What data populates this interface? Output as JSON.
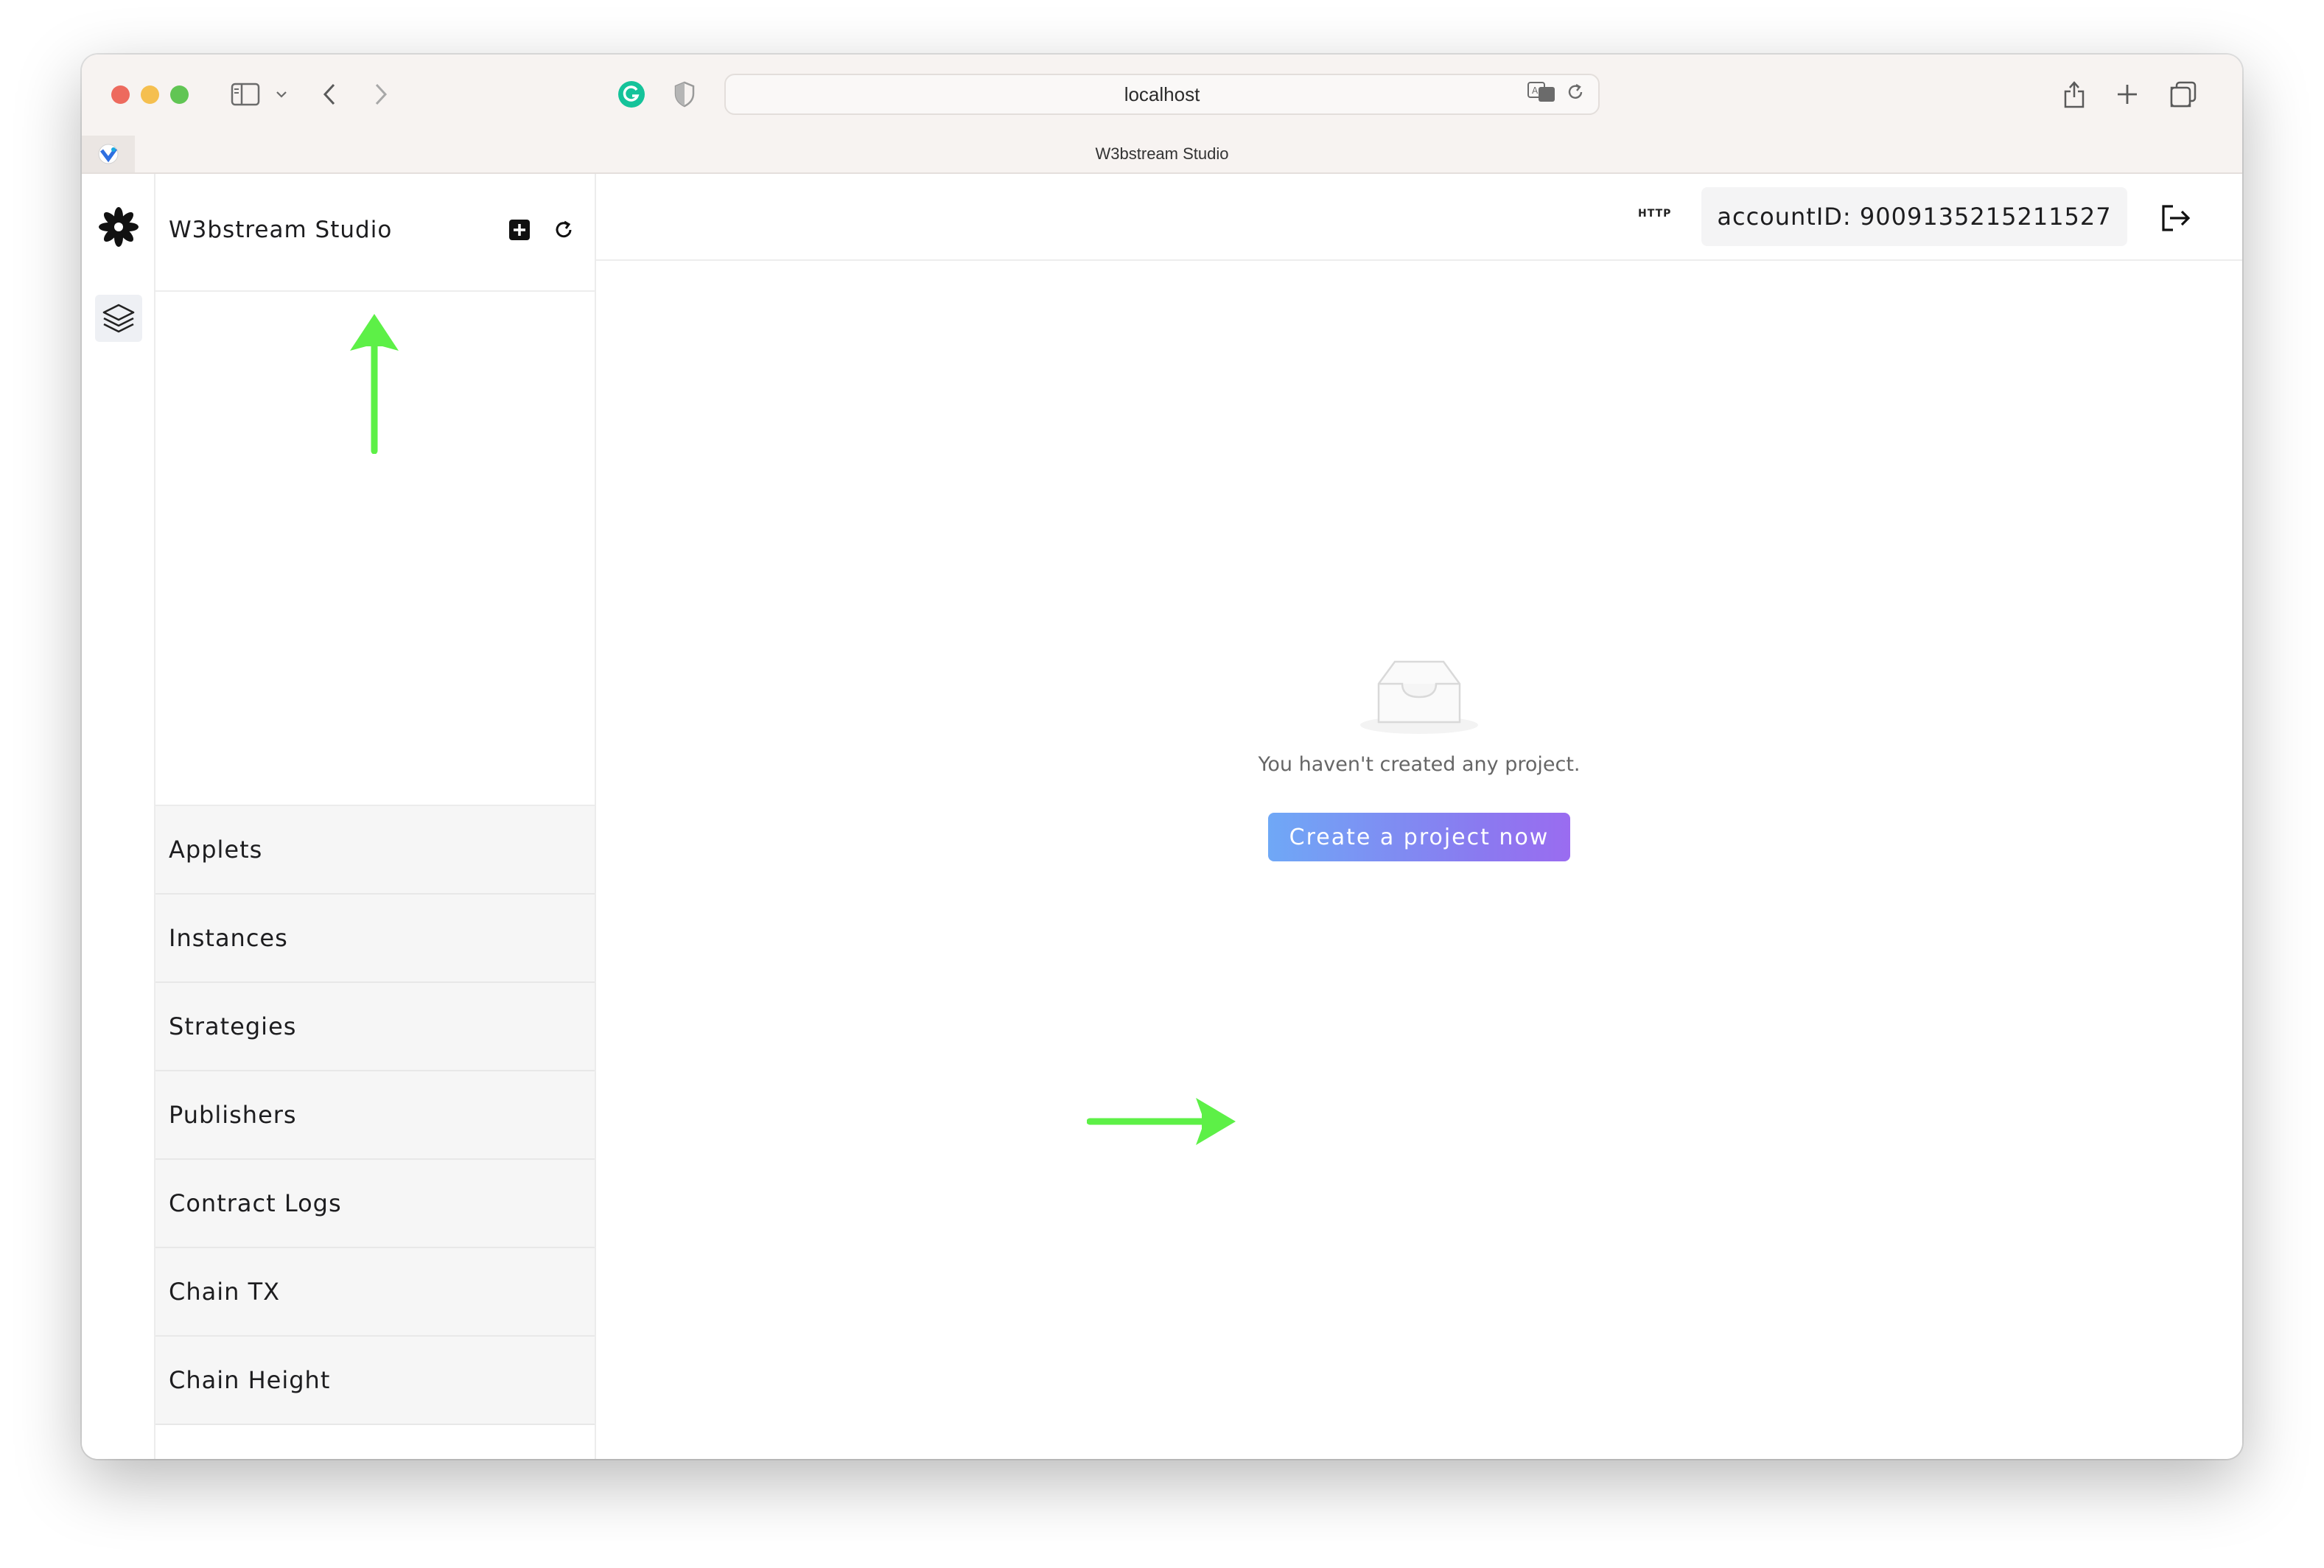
{
  "browser": {
    "url": "localhost",
    "tab_title": "W3bstream Studio"
  },
  "sidebar": {
    "title": "W3bstream Studio",
    "menu": [
      {
        "label": "Applets"
      },
      {
        "label": "Instances"
      },
      {
        "label": "Strategies"
      },
      {
        "label": "Publishers"
      },
      {
        "label": "Contract Logs"
      },
      {
        "label": "Chain TX"
      },
      {
        "label": "Chain Height"
      }
    ]
  },
  "header": {
    "protocol_badge": "HTTP",
    "account": "accountID: 9009135215211527"
  },
  "empty_state": {
    "message": "You haven't created any project.",
    "button_label": "Create a project now"
  },
  "colors": {
    "annotation_arrow": "#5df047",
    "button_gradient_start": "#6fa8f6",
    "button_gradient_end": "#9a6cf0"
  }
}
